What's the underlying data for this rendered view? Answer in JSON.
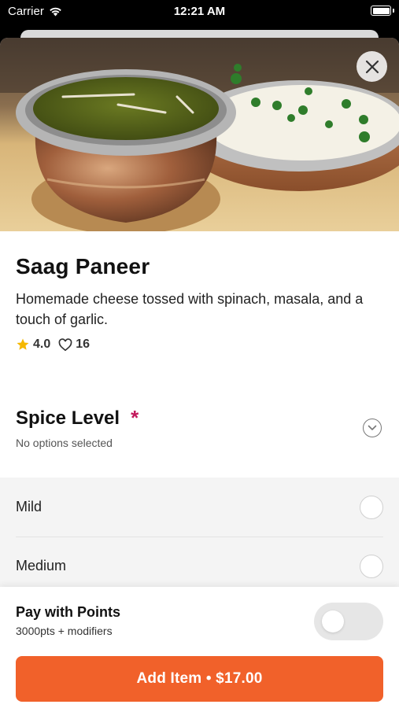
{
  "status_bar": {
    "carrier": "Carrier",
    "time": "12:21 AM"
  },
  "item": {
    "title": "Saag Paneer",
    "description": "Homemade cheese tossed with spinach, masala, and a touch of garlic.",
    "rating": "4.0",
    "likes": "16"
  },
  "spice_section": {
    "title": "Spice Level",
    "required_mark": "*",
    "subtitle": "No options selected",
    "options": [
      {
        "label": "Mild",
        "selected": false
      },
      {
        "label": "Medium",
        "selected": false
      }
    ]
  },
  "points": {
    "title": "Pay with Points",
    "subtitle": "3000pts + modifiers",
    "enabled": false
  },
  "add_button": {
    "label": "Add Item • $17.00"
  },
  "colors": {
    "accent": "#f1612a",
    "required": "#c2185b",
    "star": "#f5b800"
  },
  "icons": [
    "wifi-icon",
    "battery-icon",
    "close-icon",
    "star-icon",
    "heart-icon",
    "chevron-down-icon"
  ]
}
